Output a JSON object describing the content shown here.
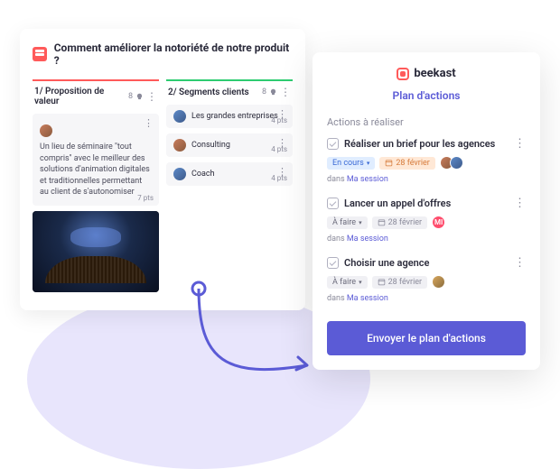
{
  "board": {
    "title": "Comment améliorer la notoriété de notre produit ?",
    "columns": [
      {
        "title": "1/ Proposition de valeur",
        "count": "8"
      },
      {
        "title": "2/ Segments clients",
        "count": "8"
      }
    ],
    "cards": {
      "value_prop": {
        "text": "Un lieu de séminaire \"tout compris\" avec le meilleur des solutions d'animation digitales et traditionnelles permettant au client de s'autonomiser",
        "pts": "7 pts"
      },
      "seg1": {
        "text": "Les grandes entreprises",
        "pts": "4 pts"
      },
      "seg2": {
        "text": "Consulting",
        "pts": "4 pts"
      },
      "seg3": {
        "text": "Coach",
        "pts": "4 pts"
      }
    }
  },
  "panel": {
    "brand": "beekast",
    "title": "Plan d'actions",
    "section": "Actions à réaliser",
    "actions": [
      {
        "title": "Réaliser un brief pour les agences",
        "status": "En cours",
        "date": "28 février",
        "session": "Ma session",
        "in": "dans"
      },
      {
        "title": "Lancer un appel d'offres",
        "status": "À faire",
        "date": "28 février",
        "session": "Ma session",
        "in": "dans"
      },
      {
        "title": "Choisir une agence",
        "status": "À faire",
        "date": "28 février",
        "session": "Ma session",
        "in": "dans"
      }
    ],
    "send": "Envoyer le plan d'actions"
  },
  "assignees": {
    "m": "MI"
  }
}
